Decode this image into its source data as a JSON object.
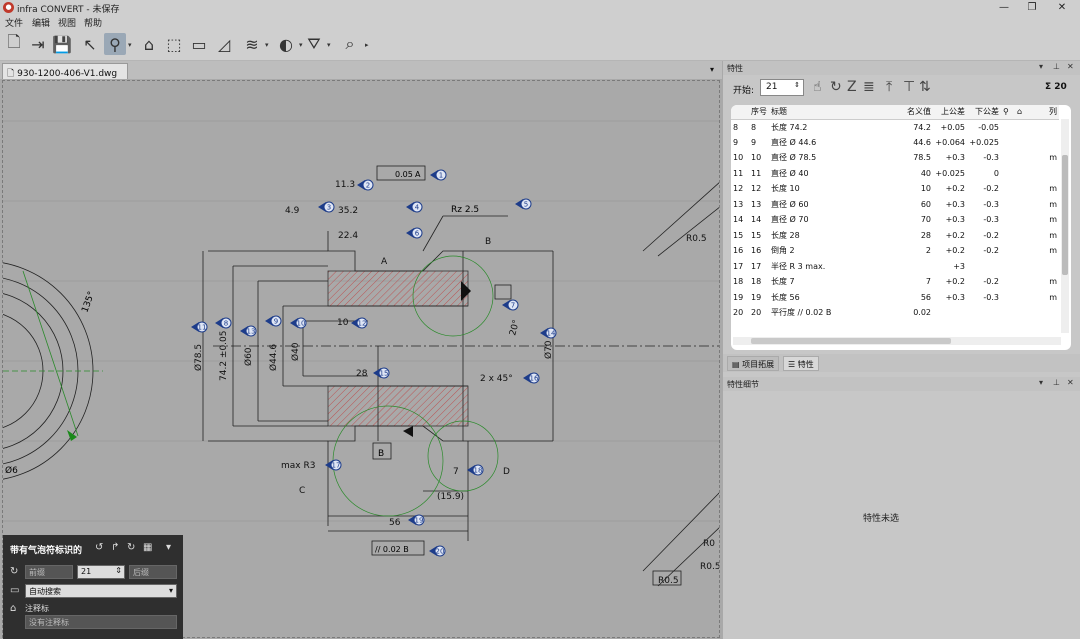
{
  "window": {
    "title": "infra CONVERT - 未保存",
    "minimize": "—",
    "maximize": "❐",
    "close": "✕"
  },
  "menu": [
    "文件",
    "编辑",
    "视图",
    "帮助"
  ],
  "doc_tab": {
    "label": "930-1200-406-V1.dwg",
    "close": "✕"
  },
  "tab_dropdown": "▾",
  "properties": {
    "header": "特性",
    "start_label": "开始:",
    "start_value": "21",
    "sum_label": "Σ 20",
    "columns": [
      "",
      "序号",
      "标题",
      "名义值",
      "上公差",
      "下公差",
      "",
      "",
      "列"
    ],
    "rows": [
      {
        "row": "8",
        "no": "8",
        "title": "长度 74.2",
        "nominal": "74.2",
        "upper": "+0.05",
        "lower": "-0.05",
        "col": ""
      },
      {
        "row": "9",
        "no": "9",
        "title": "直径 Ø 44.6",
        "nominal": "44.6",
        "upper": "+0.064",
        "lower": "+0.025",
        "col": ""
      },
      {
        "row": "10",
        "no": "10",
        "title": "直径 Ø 78.5",
        "nominal": "78.5",
        "upper": "+0.3",
        "lower": "-0.3",
        "col": "m"
      },
      {
        "row": "11",
        "no": "11",
        "title": "直径 Ø 40",
        "nominal": "40",
        "upper": "+0.025",
        "lower": "0",
        "col": ""
      },
      {
        "row": "12",
        "no": "12",
        "title": "长度 10",
        "nominal": "10",
        "upper": "+0.2",
        "lower": "-0.2",
        "col": "m"
      },
      {
        "row": "13",
        "no": "13",
        "title": "直径 Ø 60",
        "nominal": "60",
        "upper": "+0.3",
        "lower": "-0.3",
        "col": "m"
      },
      {
        "row": "14",
        "no": "14",
        "title": "直径 Ø 70",
        "nominal": "70",
        "upper": "+0.3",
        "lower": "-0.3",
        "col": "m"
      },
      {
        "row": "15",
        "no": "15",
        "title": "长度 28",
        "nominal": "28",
        "upper": "+0.2",
        "lower": "-0.2",
        "col": "m"
      },
      {
        "row": "16",
        "no": "16",
        "title": "倒角 2",
        "nominal": "2",
        "upper": "+0.2",
        "lower": "-0.2",
        "col": "m"
      },
      {
        "row": "17",
        "no": "17",
        "title": "半径 R 3 max.",
        "nominal": "",
        "upper": "+3",
        "lower": "",
        "col": ""
      },
      {
        "row": "18",
        "no": "18",
        "title": "长度 7",
        "nominal": "7",
        "upper": "+0.2",
        "lower": "-0.2",
        "col": "m"
      },
      {
        "row": "19",
        "no": "19",
        "title": "长度 56",
        "nominal": "56",
        "upper": "+0.3",
        "lower": "-0.3",
        "col": "m"
      },
      {
        "row": "20",
        "no": "20",
        "title": "平行度 // 0.02 B",
        "nominal": "0.02",
        "upper": "",
        "lower": "",
        "col": ""
      }
    ],
    "tab_project": "项目拓展",
    "tab_props": "特性"
  },
  "details": {
    "header": "特性细节",
    "empty": "特性未选"
  },
  "bubble_panel": {
    "title": "带有气泡符标识的",
    "prefix_placeholder": "前缀",
    "number": "21",
    "suffix_placeholder": "后缀",
    "mode": "自动搜索",
    "note_label": "注释标",
    "note_placeholder": "没有注释标"
  },
  "drawing": {
    "labels": {
      "A": "A",
      "B": "B",
      "C": "C",
      "D": "D",
      "B_box": "B",
      "rz": "Rz 2.5",
      "max_r3": "max R3",
      "d56": "56",
      "d28": "28",
      "d10": "10",
      "d7": "7",
      "d15_9": "(15.9)",
      "chamfer": "2 x 45°",
      "angle20": "20°",
      "angle135": "135°",
      "d78_5": "Ø78.5",
      "d74_2": "74.2 ±0.05",
      "d60": "Ø60",
      "d44_6": "Ø44.6",
      "d40": "Ø40",
      "d70": "Ø70",
      "d35": "35.2",
      "d22": "22.4",
      "d4_9": "4.9",
      "d11_3": "11.3",
      "flatness": "0.05",
      "parallel": "// 0.02 B",
      "gdt_a": "A",
      "r0_5a": "R0.5",
      "r0_5b": "R0.5",
      "r0": "R0",
      "r0_5c": "R0.5",
      "phi6": "Ø6"
    },
    "balloons": [
      "1",
      "2",
      "3",
      "4",
      "5",
      "6",
      "7",
      "8",
      "9",
      "10",
      "11",
      "12",
      "13",
      "14",
      "15",
      "16",
      "17",
      "18",
      "19",
      "20"
    ]
  }
}
